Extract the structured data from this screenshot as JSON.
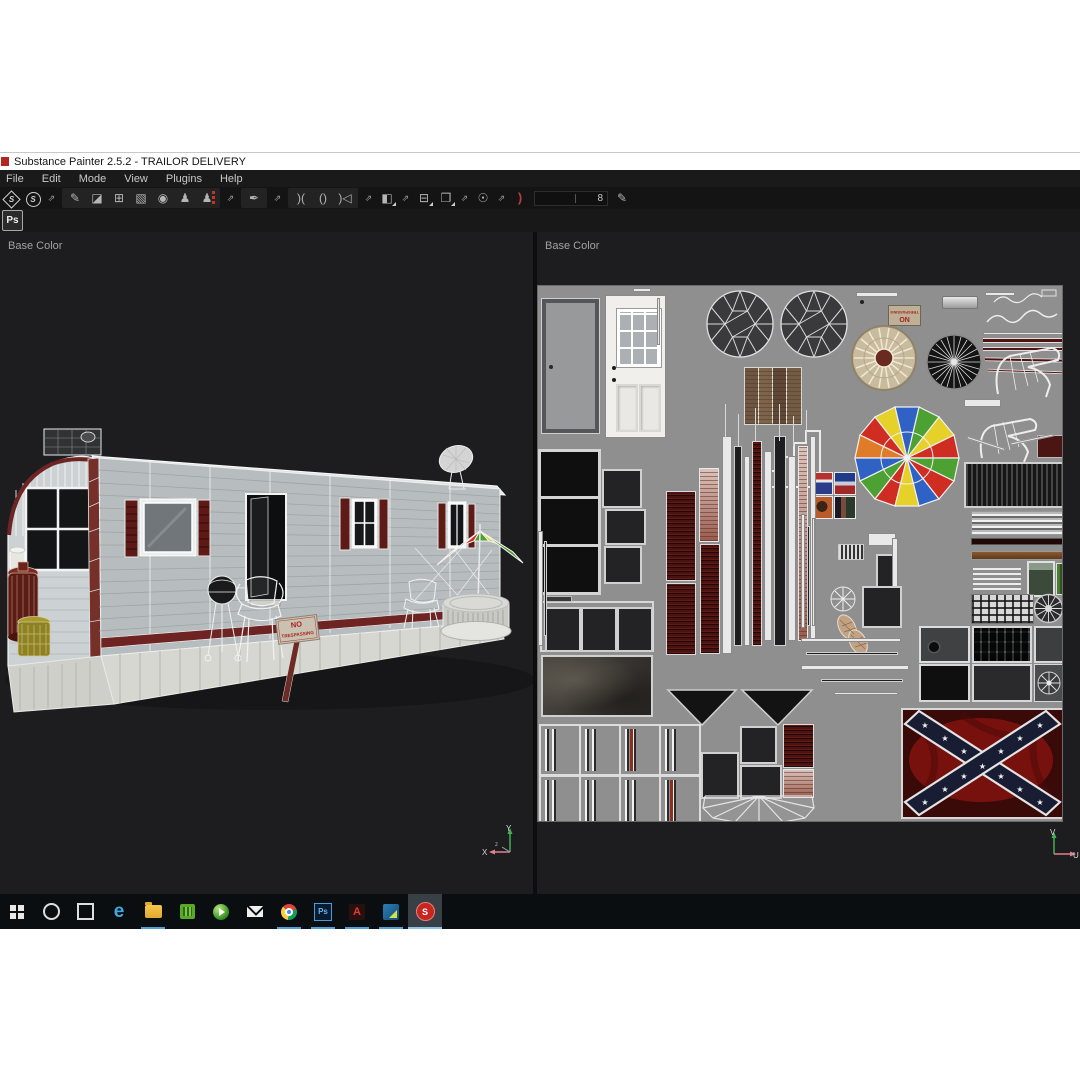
{
  "window": {
    "title": "Substance Painter 2.5.2 - TRAILOR DELIVERY"
  },
  "menu": {
    "items": [
      "File",
      "Edit",
      "Mode",
      "View",
      "Plugins",
      "Help"
    ]
  },
  "toolbar": {
    "brush_size": "8"
  },
  "icons": {
    "logo_letter": "S",
    "source_letter": "S",
    "export": "⇗",
    "brush": "✎",
    "eraser": "◪",
    "projection": "⊞",
    "polygon_fill": "▧",
    "smudge": "◉",
    "clone": "♟",
    "clone_source": "♟",
    "picker": "✒",
    "symmetry_a": ")(",
    "symmetry_b": "()",
    "symmetry_c": ")◁",
    "display": "◧",
    "projector": "⊟",
    "cube": "❒",
    "camera": "☉",
    "quick_mask": ")",
    "edit_pencil": "✎",
    "edge": "e",
    "acrobat": "A",
    "substance": "S",
    "photoshop": "Ps"
  },
  "dock": {
    "photoshop_label": "Ps"
  },
  "viewports": {
    "left": {
      "header": "Base Color",
      "gizmo": {
        "up": "Y",
        "left": "X",
        "depth": "z"
      }
    },
    "right": {
      "header": "Base Color",
      "gizmo": {
        "up": "V",
        "right": "U"
      }
    }
  },
  "scene_sign": {
    "line1": "NO",
    "line2": "TRESPASSING"
  },
  "uv_sign": {
    "line1": "NO",
    "line2": "TRESPASSING"
  },
  "taskbar": {
    "items": [
      "start",
      "cortana",
      "task-view",
      "edge",
      "file-explorer",
      "gpu-utility",
      "green-app",
      "mail",
      "chrome",
      "photoshop",
      "acrobat",
      "3ds-max",
      "substance-painter"
    ],
    "active_item": "substance-painter"
  },
  "colors": {
    "taskbar_underline": "#4f9fd8",
    "substance_red": "#c6261f",
    "uv_gray": "#8f8f8f",
    "maroon_trim": "#6e2422",
    "viewport_bg": "#1d1d1f"
  }
}
